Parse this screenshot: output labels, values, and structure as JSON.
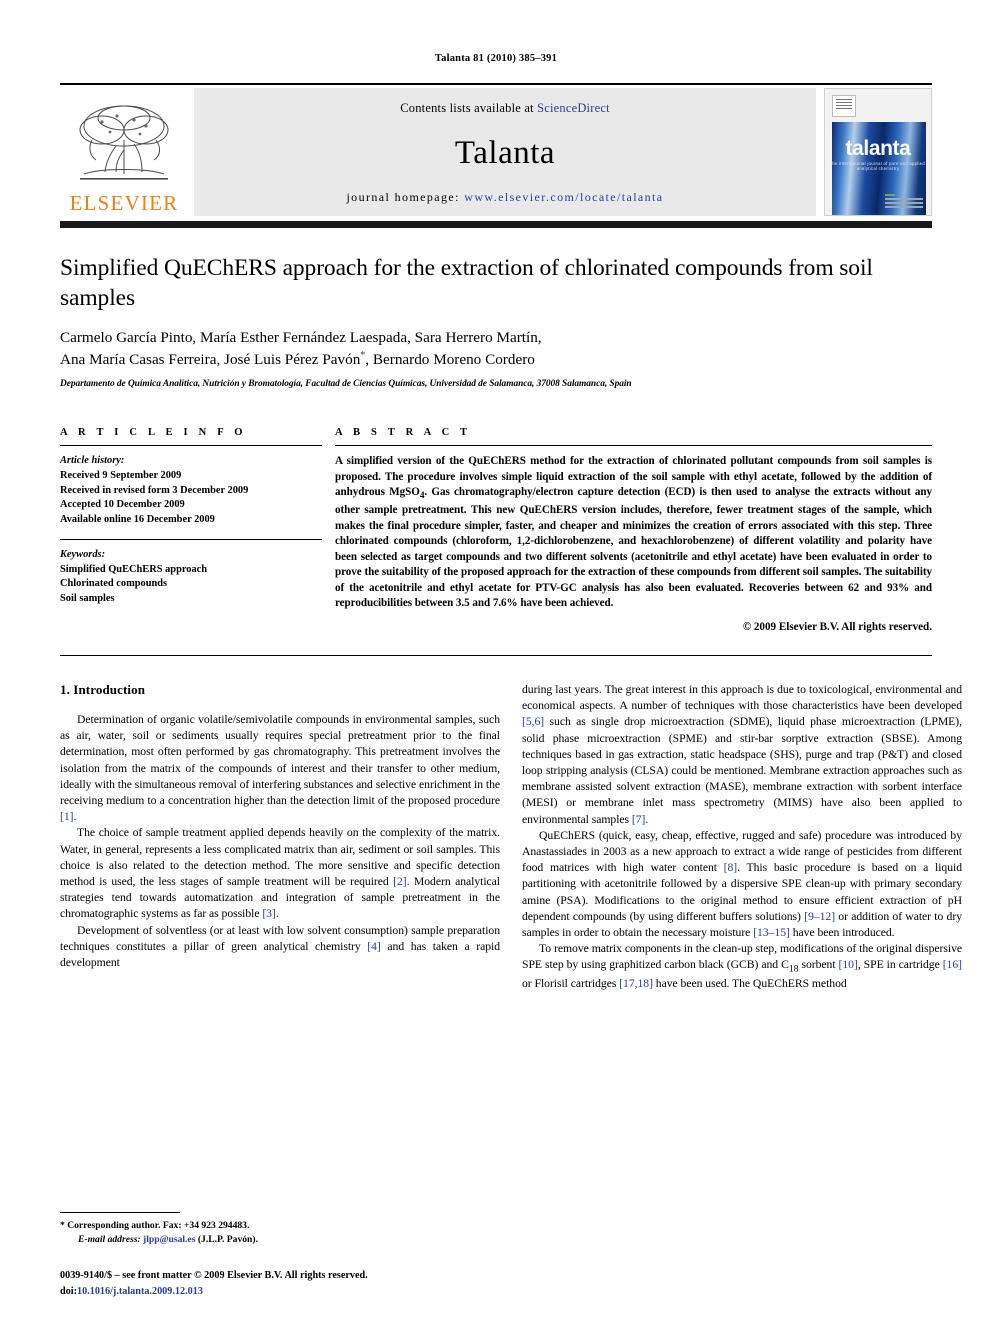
{
  "running_head": "Talanta 81 (2010) 385–391",
  "masthead": {
    "publisher_name": "ELSEVIER",
    "contents_prefix": "Contents lists available at ",
    "contents_link": "ScienceDirect",
    "journal_name": "Talanta",
    "homepage_prefix": "journal  homepage:  ",
    "homepage_url": "www.elsevier.com/locate/talanta",
    "cover_title": "talanta",
    "cover_subtitle": "the international journal of pure and applied analytical chemistry"
  },
  "article": {
    "title": "Simplified QuEChERS approach for the extraction of chlorinated compounds from soil samples",
    "authors": "Carmelo García Pinto, María Esther Fernández Laespada, Sara Herrero Martín, Ana María Casas Ferreira, José Luis Pérez Pavón",
    "authors_line1": "Carmelo García Pinto, María Esther Fernández Laespada, Sara Herrero Martín,",
    "authors_line2_a": "Ana María Casas Ferreira, José Luis Pérez Pavón",
    "authors_corresponding_mark": "*",
    "authors_line2_b": ", Bernardo Moreno Cordero",
    "affiliation": "Departamento de Química Analítica, Nutrición y Bromatología, Facultad de Ciencias Químicas, Universidad de Salamanca, 37008 Salamanca, Spain"
  },
  "article_info": {
    "heading": "A R T I C L E   I N F O",
    "history_label": "Article history:",
    "history": [
      "Received 9 September 2009",
      "Received in revised form 3 December 2009",
      "Accepted 10 December 2009",
      "Available online 16 December 2009"
    ],
    "keywords_label": "Keywords:",
    "keywords": [
      "Simplified QuEChERS approach",
      "Chlorinated compounds",
      "Soil samples"
    ]
  },
  "abstract": {
    "heading": "A B S T R A C T",
    "text": "A simplified version of the QuEChERS method for the extraction of chlorinated pollutant compounds from soil samples is proposed. The procedure involves simple liquid extraction of the soil sample with ethyl acetate, followed by the addition of anhydrous MgSO4. Gas chromatography/electron capture detection (ECD) is then used to analyse the extracts without any other sample pretreatment. This new QuEChERS version includes, therefore, fewer treatment stages of the sample, which makes the final procedure simpler, faster, and cheaper and minimizes the creation of errors associated with this step. Three chlorinated compounds (chloroform, 1,2-dichlorobenzene, and hexachlorobenzene) of different volatility and polarity have been selected as target compounds and two different solvents (acetonitrile and ethyl acetate) have been evaluated in order to prove the suitability of the proposed approach for the extraction of these compounds from different soil samples. The suitability of the acetonitrile and ethyl acetate for PTV-GC analysis has also been evaluated. Recoveries between 62 and 93% and reproducibilities between 3.5 and 7.6% have been achieved.",
    "copyright": "© 2009 Elsevier B.V. All rights reserved."
  },
  "body": {
    "section_number_title": "1.  Introduction",
    "left_paragraphs": [
      "Determination of organic volatile/semivolatile compounds in environmental samples, such as air, water, soil or sediments usually requires special pretreatment prior to the final determination, most often performed by gas chromatography. This pretreatment involves the isolation from the matrix of the compounds of interest and their transfer to other medium, ideally with the simultaneous removal of interfering substances and selective enrichment in the receiving medium to a concentration higher than the detection limit of the proposed procedure [1].",
      "The choice of sample treatment applied depends heavily on the complexity of the matrix. Water, in general, represents a less complicated matrix than air, sediment or soil samples. This choice is also related to the detection method. The more sensitive and specific detection method is used, the less stages of sample treatment will be required [2]. Modern analytical strategies tend towards automatization and integration of sample pretreatment in the chromatographic systems as far as possible [3].",
      "Development of solventless (or at least with low solvent consumption) sample preparation techniques constitutes a pillar of green analytical chemistry [4] and has taken a rapid development"
    ],
    "right_paragraphs": [
      "during last years. The great interest in this approach is due to toxicological, environmental and economical aspects. A number of techniques with those characteristics have been developed [5,6] such as single drop microextraction (SDME), liquid phase microextraction (LPME), solid phase microextraction (SPME) and stir-bar sorptive extraction (SBSE). Among techniques based in gas extraction, static headspace (SHS), purge and trap (P&T) and closed loop stripping analysis (CLSA) could be mentioned. Membrane extraction approaches such as membrane assisted solvent extraction (MASE), membrane extraction with sorbent interface (MESI) or membrane inlet mass spectrometry (MIMS) have also been applied to environmental samples [7].",
      "QuEChERS (quick, easy, cheap, effective, rugged and safe) procedure was introduced by Anastassiades in 2003 as a new approach to extract a wide range of pesticides from different food matrices with high water content [8]. This basic procedure is based on a liquid partitioning with acetonitrile followed by a dispersive SPE clean-up with primary secondary amine (PSA). Modifications to the original method to ensure efficient extraction of pH dependent compounds (by using different buffers solutions) [9–12] or addition of water to dry samples in order to obtain the necessary moisture [13–15] have been introduced.",
      "To remove matrix components in the clean-up step, modifications of the original dispersive SPE step by using graphitized carbon black (GCB) and C18 sorbent [10], SPE in cartridge [16] or Florisil cartridges [17,18] have been used. The QuEChERS method"
    ]
  },
  "footnotes": {
    "corresponding_mark": "*",
    "corresponding": "Corresponding author. Fax: +34 923 294483.",
    "email_label": "E-mail address:",
    "email": "jlpp@usal.es",
    "email_owner": "(J.L.P. Pavón).",
    "issn_line": "0039-9140/$ – see front matter © 2009 Elsevier B.V. All rights reserved.",
    "doi_label": "doi:",
    "doi_value": "10.1016/j.talanta.2009.12.013"
  },
  "colors": {
    "link": "#2a3c9c",
    "elsevier_orange": "#f08010",
    "masthead_grey": "#e9e9e9"
  }
}
